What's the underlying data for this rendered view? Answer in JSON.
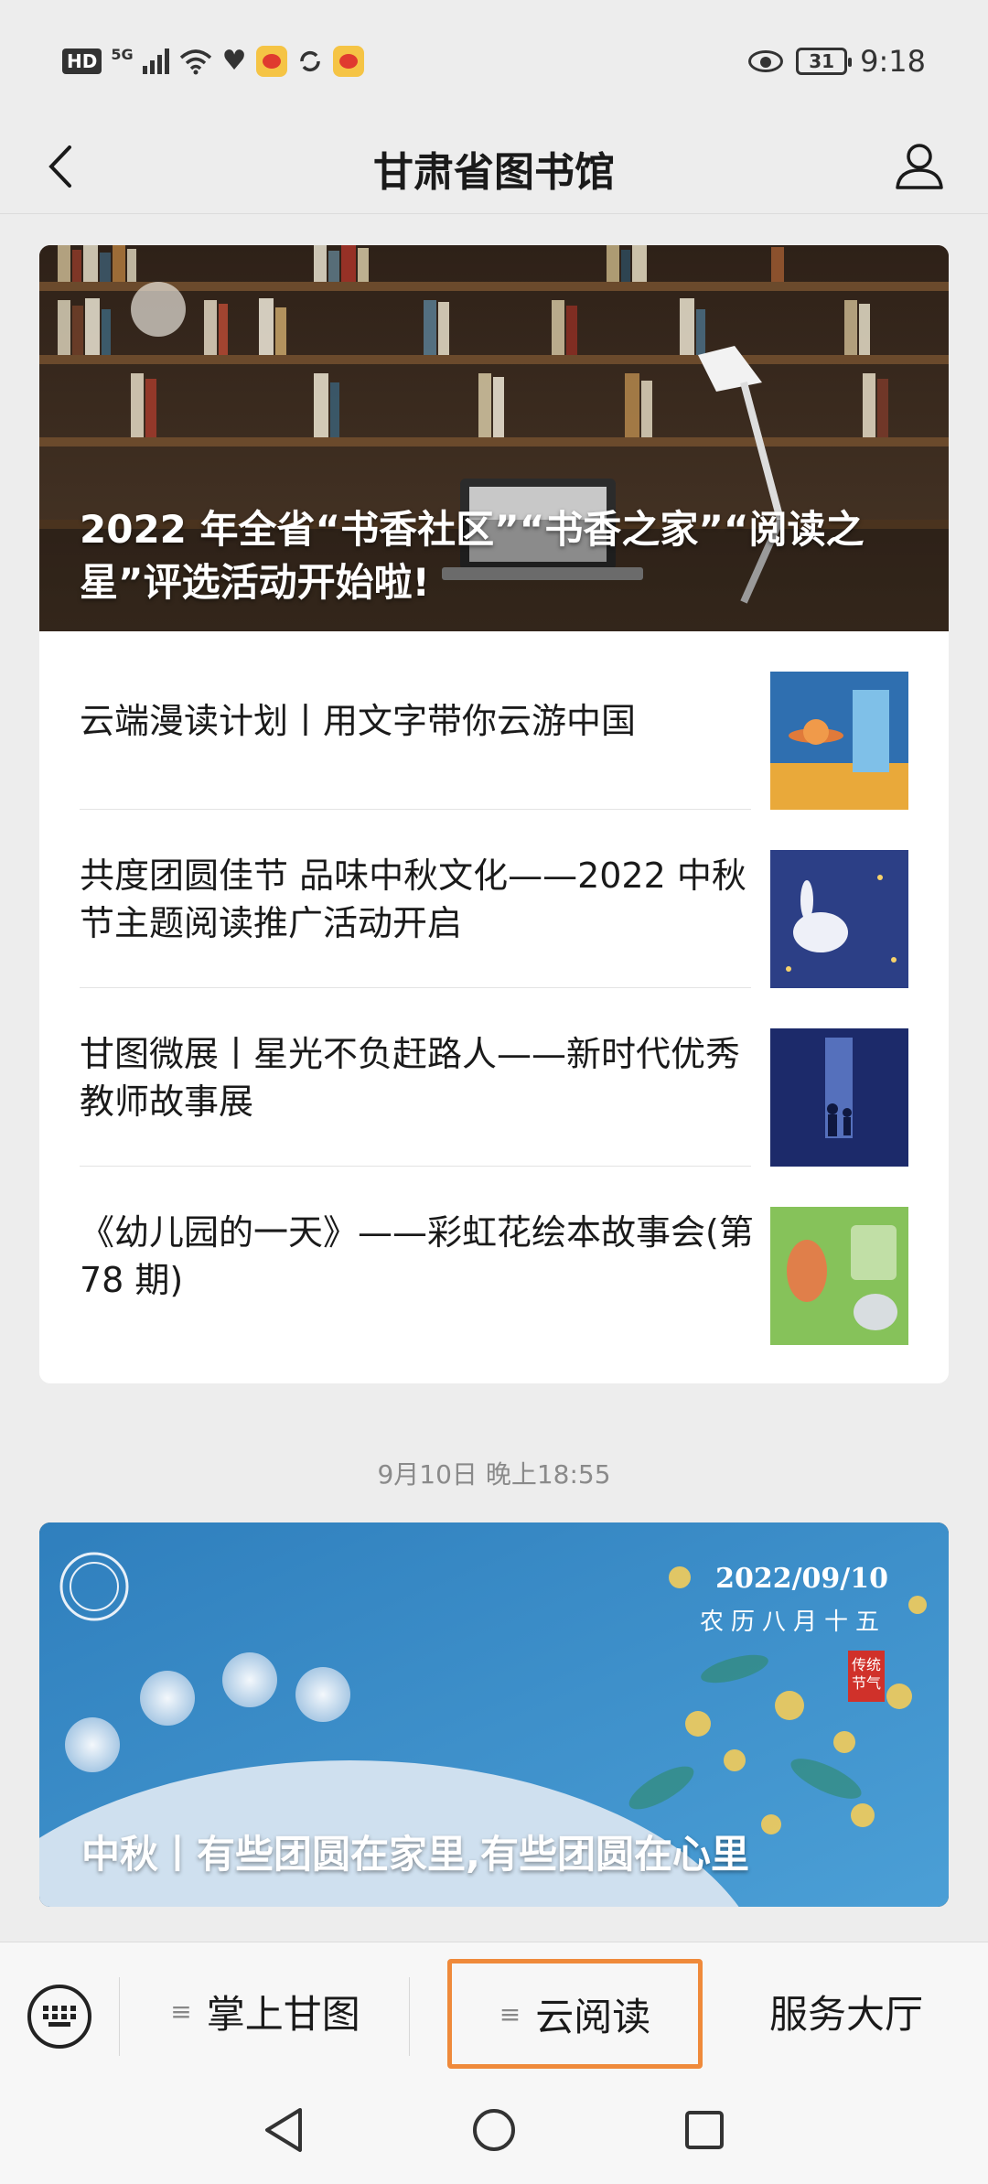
{
  "status_bar": {
    "hd": "HD",
    "network": "5G",
    "battery": "31",
    "time": "9:18",
    "icons": [
      "signal-icon",
      "wifi-icon",
      "heart-icon",
      "weibo-icon",
      "sync-icon",
      "weibo-icon",
      "eye-icon",
      "battery-icon"
    ]
  },
  "nav": {
    "title": "甘肃省图书馆",
    "back_icon": "chevron-left-icon",
    "profile_icon": "user-icon"
  },
  "article_group_1": {
    "hero_title": "2022 年全省“书香社区”“书香之家”“阅读之星”评选活动开始啦!",
    "items": [
      {
        "title": "云端漫读计划丨用文字带你云游中国"
      },
      {
        "title": "共度团圆佳节 品味中秋文化——2022 中秋节主题阅读推广活动开启"
      },
      {
        "title": "甘图微展丨星光不负赶路人——新时代优秀教师故事展"
      },
      {
        "title": "《幼儿园的一天》——彩虹花绘本故事会(第 78 期)"
      }
    ]
  },
  "timestamp": "9月10日 晚上18:55",
  "article_group_2": {
    "hero_title": "中秋丨有些团圆在家里,有些团圆在心里",
    "date_text": "2022/09/10",
    "lunar_text": "农历八月十五",
    "seal_text": "传统节气"
  },
  "bottom_menu": {
    "keyboard_icon": "keyboard-icon",
    "items": [
      {
        "label": "掌上甘图"
      },
      {
        "label": "云阅读"
      },
      {
        "label": "服务大厅"
      }
    ],
    "menu_icon": "menu-icon",
    "highlight_color": "#ef8a3b"
  },
  "system_nav": {
    "back_icon": "triangle-back-icon",
    "home_icon": "circle-home-icon",
    "recents_icon": "square-recents-icon"
  }
}
